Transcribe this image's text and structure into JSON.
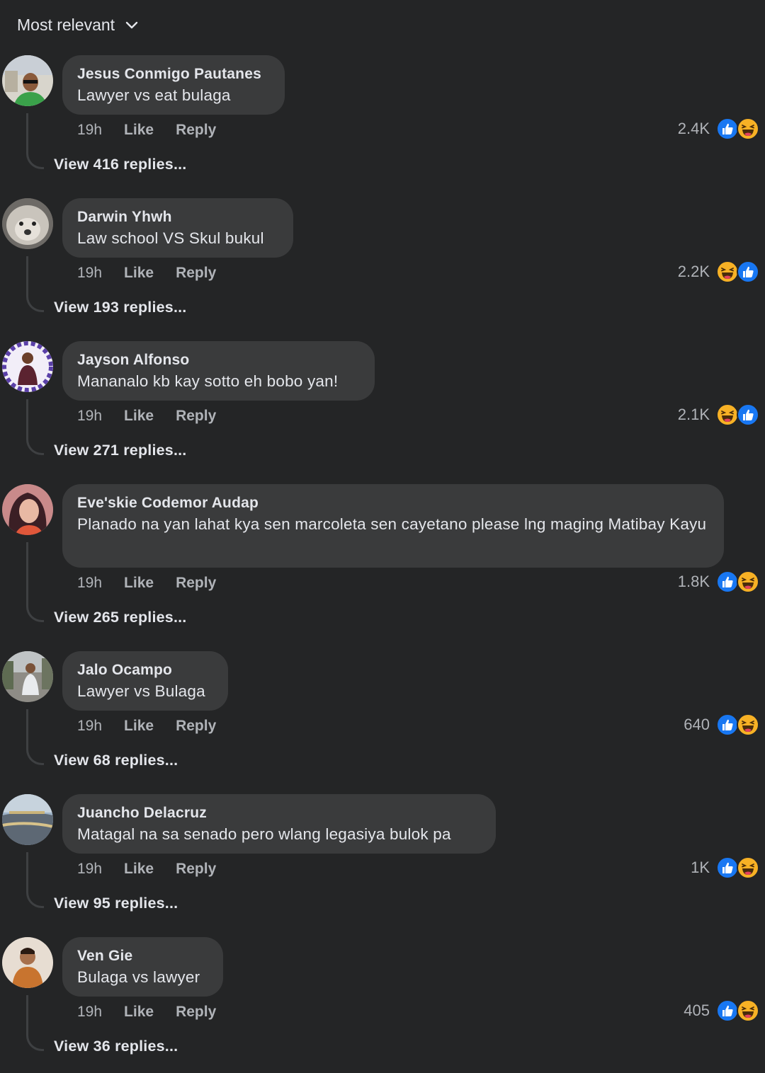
{
  "sort": {
    "label": "Most relevant",
    "icon": "chevron-down-icon"
  },
  "colors": {
    "background": "#242526",
    "bubble": "#3a3b3c",
    "text": "#e4e6eb",
    "muted": "#b0b3b8",
    "like_blue": "#1877f2",
    "haha_yellow": "#f7b125"
  },
  "comments": [
    {
      "author": "Jesus Conmigo Pautanes",
      "text": "Lawyer vs eat bulaga",
      "time": "19h",
      "like": "Like",
      "reply": "Reply",
      "reactions_count": "2.4K",
      "reactions": [
        "like-icon",
        "haha-icon"
      ],
      "view_replies": "View 416 replies..."
    },
    {
      "author": "Darwin Yhwh",
      "text": "Law school VS Skul bukul",
      "time": "19h",
      "like": "Like",
      "reply": "Reply",
      "reactions_count": "2.2K",
      "reactions": [
        "haha-icon",
        "like-icon"
      ],
      "view_replies": "View 193 replies..."
    },
    {
      "author": "Jayson Alfonso",
      "text": "Mananalo kb kay sotto eh bobo yan!",
      "time": "19h",
      "like": "Like",
      "reply": "Reply",
      "reactions_count": "2.1K",
      "reactions": [
        "haha-icon",
        "like-icon"
      ],
      "view_replies": "View 271 replies..."
    },
    {
      "author": "Eve'skie Codemor Audap",
      "text": "Planado na yan lahat kya sen marcoleta sen cayetano please lng maging Matibay Kayu",
      "time": "19h",
      "like": "Like",
      "reply": "Reply",
      "reactions_count": "1.8K",
      "reactions": [
        "like-icon",
        "haha-icon"
      ],
      "view_replies": "View 265 replies..."
    },
    {
      "author": "Jalo Ocampo",
      "text": "Lawyer vs Bulaga",
      "time": "19h",
      "like": "Like",
      "reply": "Reply",
      "reactions_count": "640",
      "reactions": [
        "like-icon",
        "haha-icon"
      ],
      "view_replies": "View 68 replies..."
    },
    {
      "author": "Juancho Delacruz",
      "text": "Matagal na sa senado pero wlang legasiya bulok pa",
      "time": "19h",
      "like": "Like",
      "reply": "Reply",
      "reactions_count": "1K",
      "reactions": [
        "like-icon",
        "haha-icon"
      ],
      "view_replies": "View 95 replies..."
    },
    {
      "author": "Ven Gie",
      "text": "Bulaga vs lawyer",
      "time": "19h",
      "like": "Like",
      "reply": "Reply",
      "reactions_count": "405",
      "reactions": [
        "like-icon",
        "haha-icon"
      ],
      "view_replies": "View 36 replies..."
    }
  ]
}
